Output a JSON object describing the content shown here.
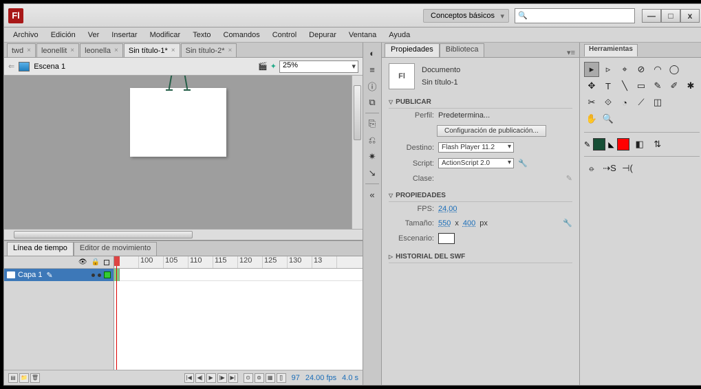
{
  "app": {
    "logo": "Fl"
  },
  "workspace": {
    "label": "Conceptos básicos"
  },
  "search": {
    "placeholder": ""
  },
  "window": {
    "min": "—",
    "max": "□",
    "close": "x"
  },
  "menu": [
    "Archivo",
    "Edición",
    "Ver",
    "Insertar",
    "Modificar",
    "Texto",
    "Comandos",
    "Control",
    "Depurar",
    "Ventana",
    "Ayuda"
  ],
  "doctabs": [
    {
      "label": "twd",
      "active": false
    },
    {
      "label": "leonellit",
      "active": false
    },
    {
      "label": "leonella",
      "active": false
    },
    {
      "label": "Sin título-1*",
      "active": true
    },
    {
      "label": "Sin título-2*",
      "active": false
    }
  ],
  "editbar": {
    "scene": "Escena 1",
    "zoom": "25%"
  },
  "timeline": {
    "tabs": {
      "timeline": "Línea de tiempo",
      "motion": "Editor de movimiento"
    },
    "layer": "Capa 1",
    "ruler": [
      "",
      "100",
      "105",
      "110",
      "115",
      "120",
      "125",
      "130",
      "13"
    ],
    "status": {
      "frame": "97",
      "fps": "24.00 fps",
      "time": "4.0 s"
    }
  },
  "midtools": [
    "◐",
    "≡",
    "ⓘ",
    "⧉",
    "—",
    "⎘",
    "⎌",
    "✷",
    "↘",
    "—",
    "«"
  ],
  "properties": {
    "tabs": {
      "props": "Propiedades",
      "lib": "Biblioteca"
    },
    "doc_type": "Documento",
    "doc_name": "Sin título-1",
    "publish": {
      "head": "PUBLICAR",
      "profile_label": "Perfil:",
      "profile_value": "Predetermina...",
      "config_btn": "Configuración de publicación...",
      "target_label": "Destino:",
      "target_value": "Flash Player 11.2",
      "script_label": "Script:",
      "script_value": "ActionScript 2.0",
      "class_label": "Clase:"
    },
    "props_section": {
      "head": "PROPIEDADES",
      "fps_label": "FPS:",
      "fps_value": "24,00",
      "size_label": "Tamaño:",
      "w": "550",
      "x": "x",
      "h": "400",
      "px": "px",
      "stage_label": "Escenario:"
    },
    "swf": {
      "head": "HISTORIAL DEL SWF"
    }
  },
  "tools": {
    "head": "Herramientas",
    "row1": [
      "▸",
      "▹",
      "⌖",
      "⊘",
      "◠",
      "◯"
    ],
    "row2": [
      "✥",
      "T",
      "╲",
      "▭",
      "✎",
      "✐",
      "✱"
    ],
    "row3": [
      "✂",
      "⟐",
      "◔",
      "⟋",
      "◫"
    ],
    "row4": [
      "✋",
      "🔍"
    ],
    "stroke_color": "#174f36",
    "fill_color": "#ff0000",
    "row5": [
      "⦵",
      "⇢S",
      "⊣("
    ]
  }
}
